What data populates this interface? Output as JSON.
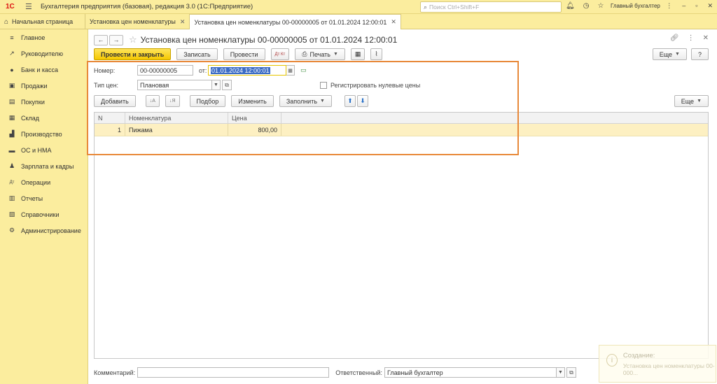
{
  "app": {
    "title": "Бухгалтерия предприятия (базовая), редакция 3.0  (1С:Предприятие)",
    "logo": "1С",
    "search_placeholder": "Поиск Ctrl+Shift+F",
    "user": "Главный бухгалтер"
  },
  "tabs": [
    {
      "label": "Начальная страница"
    },
    {
      "label": "Установка цен номенклатуры"
    },
    {
      "label": "Установка цен номенклатуры 00-00000005 от 01.01.2024 12:00:01"
    }
  ],
  "sidebar": {
    "items": [
      {
        "label": "Главное",
        "icon": "≡"
      },
      {
        "label": "Руководителю",
        "icon": "↗"
      },
      {
        "label": "Банк и касса",
        "icon": "●"
      },
      {
        "label": "Продажи",
        "icon": "▣"
      },
      {
        "label": "Покупки",
        "icon": "▤"
      },
      {
        "label": "Склад",
        "icon": "▦"
      },
      {
        "label": "Производство",
        "icon": "▟"
      },
      {
        "label": "ОС и НМА",
        "icon": "▬"
      },
      {
        "label": "Зарплата и кадры",
        "icon": "♟"
      },
      {
        "label": "Операции",
        "icon": "Дт"
      },
      {
        "label": "Отчеты",
        "icon": "▥"
      },
      {
        "label": "Справочники",
        "icon": "▧"
      },
      {
        "label": "Администрирование",
        "icon": "⚙"
      }
    ]
  },
  "document": {
    "title": "Установка цен номенклатуры 00-00000005 от 01.01.2024 12:00:01"
  },
  "toolbar": {
    "post_close": "Провести и закрыть",
    "save": "Записать",
    "post": "Провести",
    "dt_kt": "Дт Кт",
    "print": "Печать",
    "more": "Еще",
    "help": "?"
  },
  "form": {
    "number_label": "Номер:",
    "number_value": "00-00000005",
    "date_label": "от:",
    "date_value": "01.01.2024 12:00:01",
    "price_type_label": "Тип цен:",
    "price_type_value": "Плановая",
    "zero_prices_label": "Регистрировать нулевые цены"
  },
  "table_toolbar": {
    "add": "Добавить",
    "pick": "Подбор",
    "change": "Изменить",
    "fill": "Заполнить",
    "more": "Еще"
  },
  "table": {
    "columns": [
      "N",
      "Номенклатура",
      "Цена"
    ],
    "rows": [
      {
        "n": "1",
        "item": "Пижама",
        "price": "800,00"
      }
    ]
  },
  "footer": {
    "comment_label": "Комментарий:",
    "comment_value": "",
    "responsible_label": "Ответственный:",
    "responsible_value": "Главный бухгалтер"
  },
  "notification": {
    "title": "Создание:",
    "message": "Установка цен номенклатуры 00-000..."
  }
}
